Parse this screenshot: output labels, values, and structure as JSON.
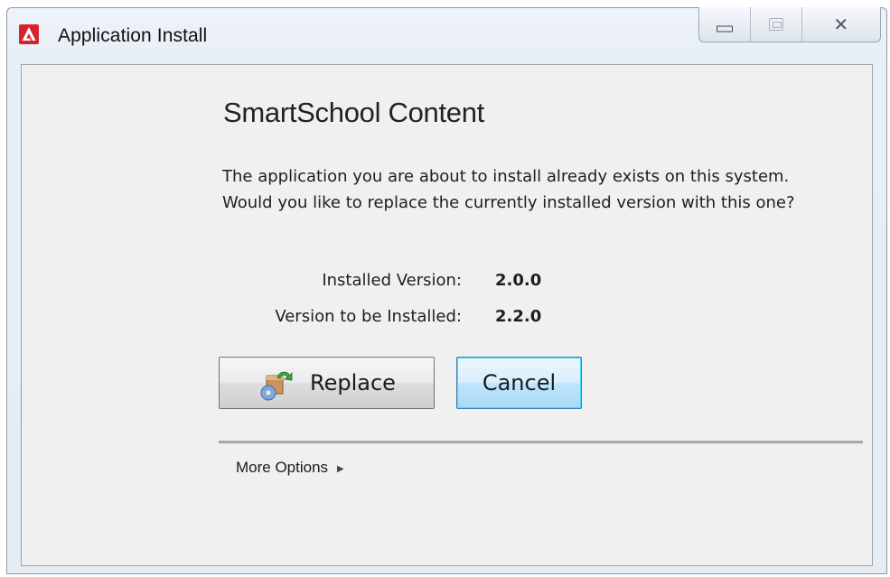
{
  "window": {
    "title": "Application Install",
    "icon": "adobe-air-icon",
    "controls": {
      "minimize": "minimize-icon",
      "maximize": "maximize-icon",
      "close": "close-icon",
      "close_glyph": "✕"
    }
  },
  "dialog": {
    "heading": "SmartSchool Content",
    "message": "The application you are about to install already exists on this system. Would you like to replace the currently installed version with this one?",
    "installed_label": "Installed Version:",
    "installed_value": "2.0.0",
    "new_label": "Version to be Installed:",
    "new_value": "2.2.0",
    "replace_button": "Replace",
    "replace_icon": "replace-package-icon",
    "cancel_button": "Cancel",
    "more_options": "More Options",
    "more_options_arrow": "▶"
  },
  "colors": {
    "app_icon_red": "#d8222a",
    "focus_button_border": "#3c7fb1"
  }
}
